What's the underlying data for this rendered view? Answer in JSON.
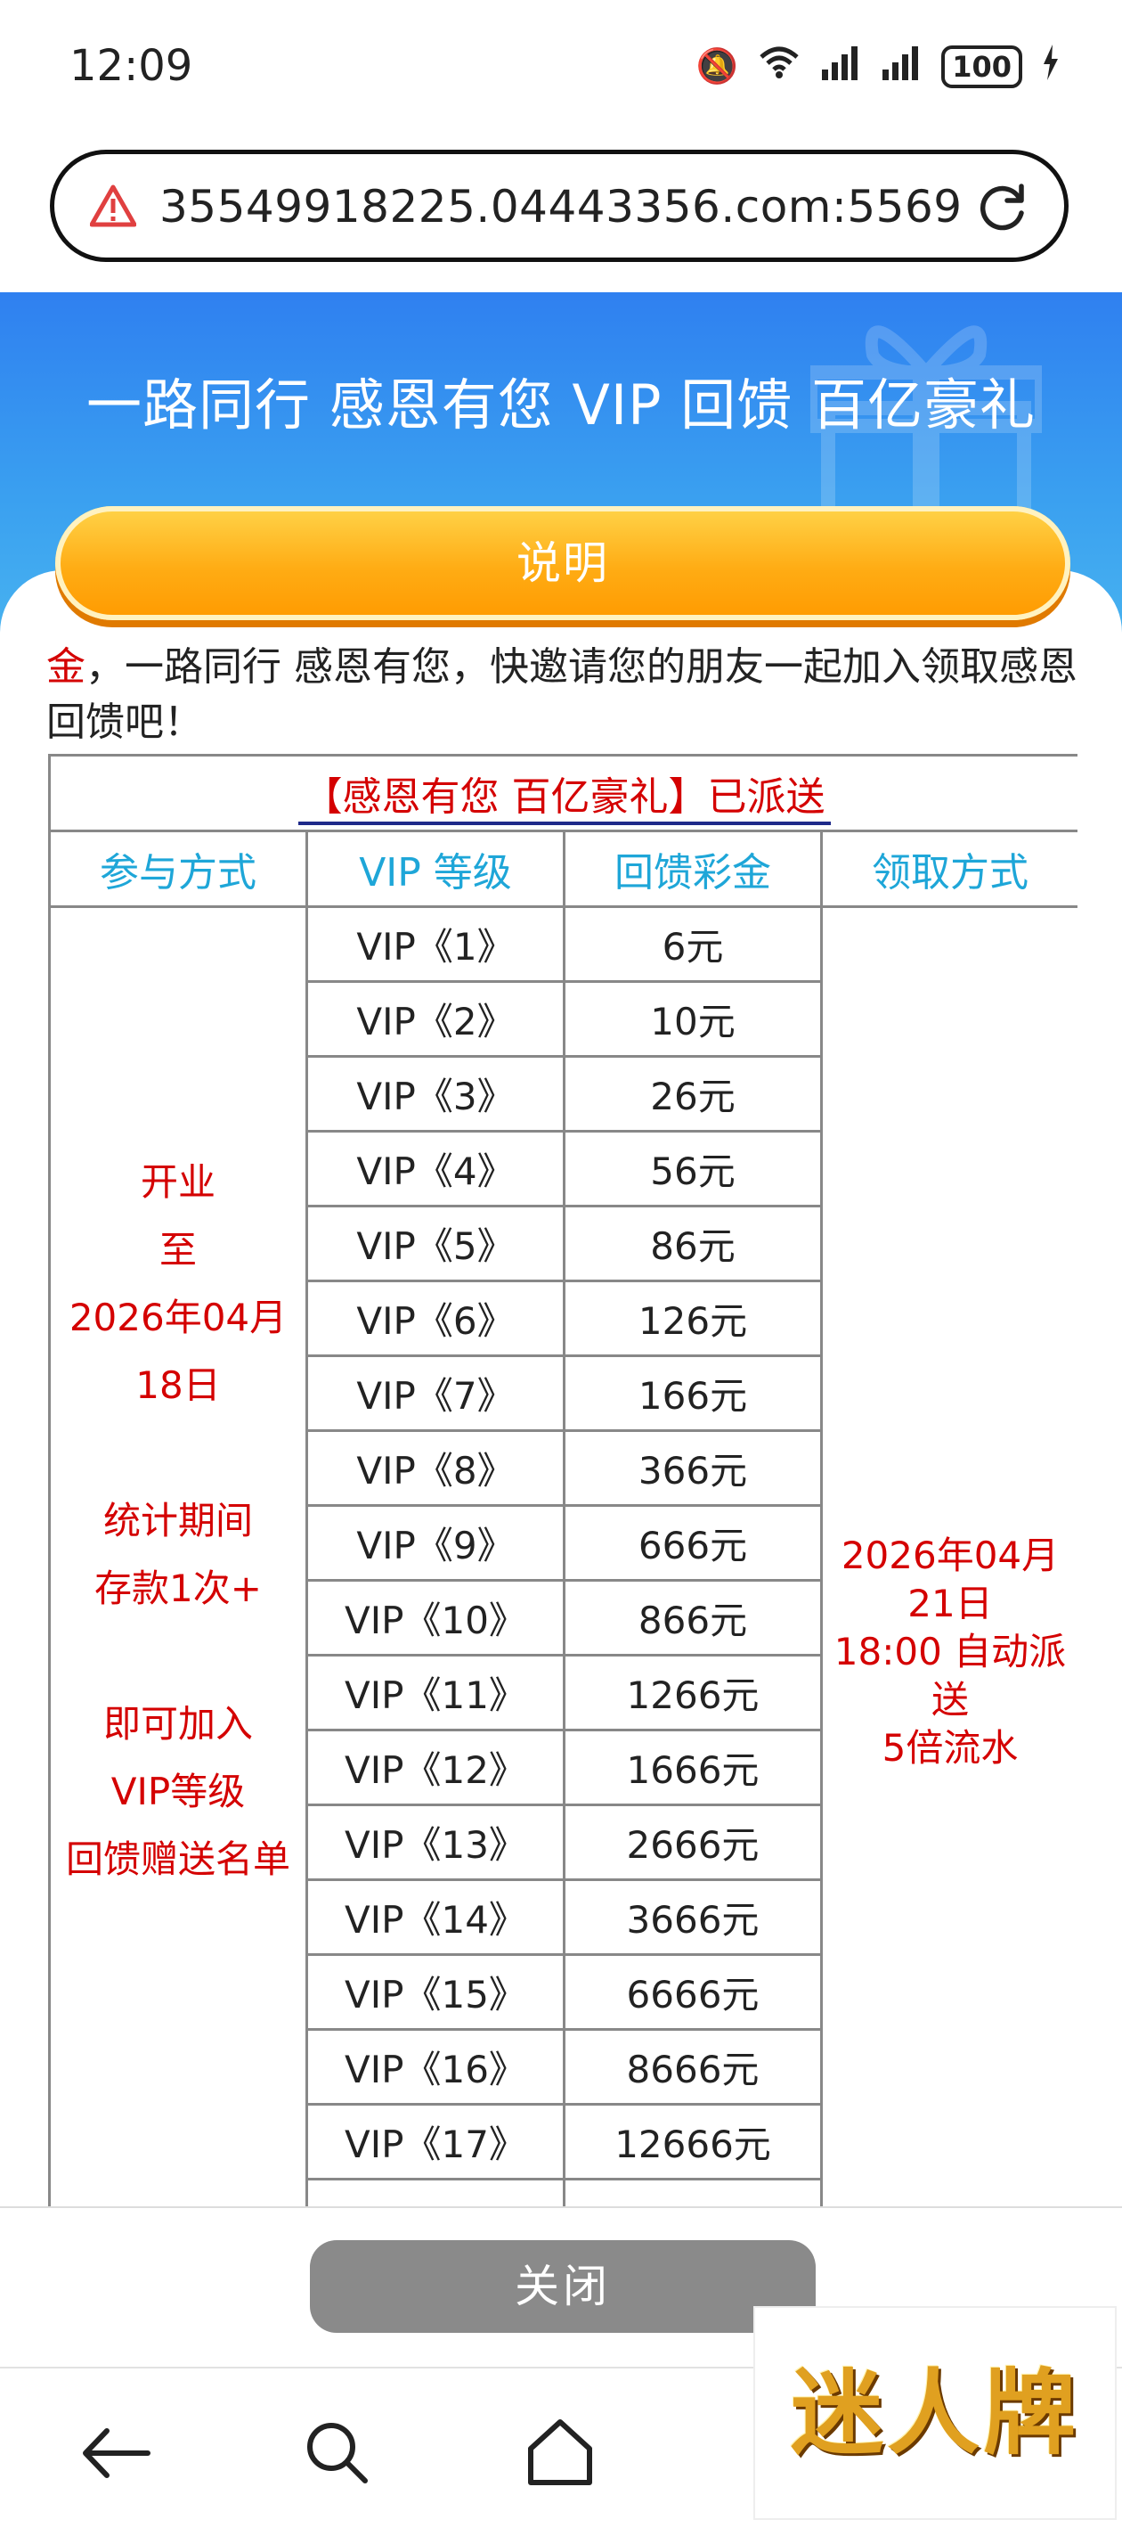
{
  "status_bar": {
    "time": "12:09",
    "battery": "100"
  },
  "url_bar": {
    "url": "35549918225.04443356.com:5569"
  },
  "banner": {
    "title": "一路同行 感恩有您 VIP 回馈 百亿豪礼",
    "explain_button": "说明"
  },
  "intro": {
    "lead": "金",
    "text": "，一路同行 感恩有您，快邀请您的朋友一起加入领取感恩回馈吧！"
  },
  "table": {
    "caption": "【感恩有您  百亿豪礼】已派送",
    "headers": [
      "参与方式",
      "VIP 等级",
      "回馈彩金",
      "领取方式"
    ],
    "participation": [
      "开业",
      "至",
      "2026年04月",
      "18日",
      "",
      "统计期间",
      "存款1次+",
      "",
      "即可加入",
      "VIP等级",
      "回馈赠送名单"
    ],
    "claim": [
      "2026年04月",
      "21日",
      "18:00 自动派",
      "送",
      "5倍流水"
    ],
    "rows": [
      {
        "level": "VIP《1》",
        "amount": "6元"
      },
      {
        "level": "VIP《2》",
        "amount": "10元"
      },
      {
        "level": "VIP《3》",
        "amount": "26元"
      },
      {
        "level": "VIP《4》",
        "amount": "56元"
      },
      {
        "level": "VIP《5》",
        "amount": "86元"
      },
      {
        "level": "VIP《6》",
        "amount": "126元"
      },
      {
        "level": "VIP《7》",
        "amount": "166元"
      },
      {
        "level": "VIP《8》",
        "amount": "366元"
      },
      {
        "level": "VIP《9》",
        "amount": "666元"
      },
      {
        "level": "VIP《10》",
        "amount": "866元"
      },
      {
        "level": "VIP《11》",
        "amount": "1266元"
      },
      {
        "level": "VIP《12》",
        "amount": "1666元"
      },
      {
        "level": "VIP《13》",
        "amount": "2666元"
      },
      {
        "level": "VIP《14》",
        "amount": "3666元"
      },
      {
        "level": "VIP《15》",
        "amount": "6666元"
      },
      {
        "level": "VIP《16》",
        "amount": "8666元"
      },
      {
        "level": "VIP《17》",
        "amount": "12666元"
      },
      {
        "level": "",
        "amount": ""
      }
    ]
  },
  "close_button": "关闭",
  "watermark": "迷人牌",
  "icons": {
    "warning": "warning-triangle-icon",
    "reload": "reload-icon",
    "back": "back-arrow-icon",
    "search": "search-icon",
    "home": "home-icon"
  }
}
